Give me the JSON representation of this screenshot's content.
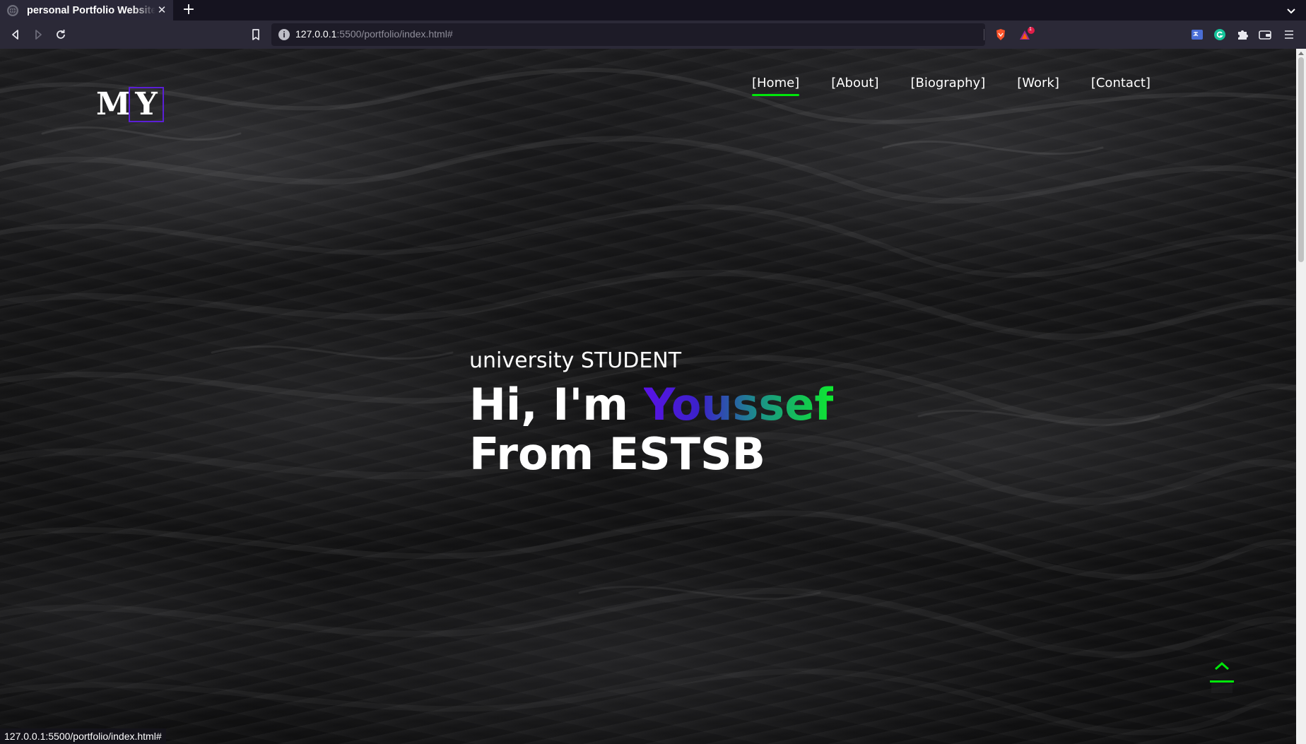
{
  "browser": {
    "tab_title": "personal Portfolio Website",
    "tab_close": "✕",
    "new_tab": "+",
    "url_host": "127.0.0.1",
    "url_rest": ":5500/portfolio/index.html#",
    "url_info": "i",
    "rewards_badge": "1",
    "status_url": "127.0.0.1:5500/portfolio/index.html#"
  },
  "page": {
    "logo": {
      "m": "M",
      "y": "Y"
    },
    "nav": [
      {
        "label": "[Home]",
        "active": true
      },
      {
        "label": "[About]"
      },
      {
        "label": "[Biography]"
      },
      {
        "label": "[Work]"
      },
      {
        "label": "[Contact]"
      }
    ],
    "hero": {
      "subtitle": "university STUDENT",
      "greeting": "Hi, I'm",
      "name": "Youssef",
      "from": "From ESTSB"
    }
  },
  "colors": {
    "accent_purple": "#5b1fd6",
    "accent_green": "#00e60a"
  }
}
